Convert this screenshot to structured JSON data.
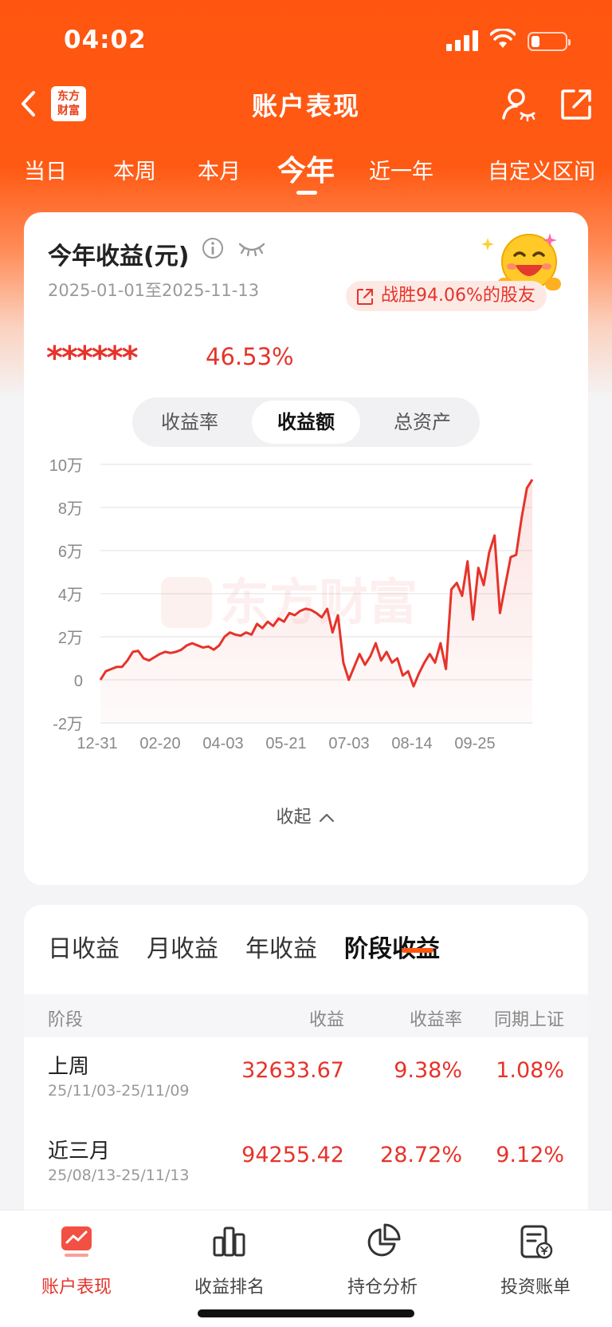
{
  "status_bar": {
    "time": "04:02"
  },
  "nav": {
    "logo_line1": "东方",
    "logo_line2": "财富",
    "title": "账户表现"
  },
  "period_tabs": [
    {
      "label": "当日"
    },
    {
      "label": "本周"
    },
    {
      "label": "本月"
    },
    {
      "label": "今年",
      "active": true
    },
    {
      "label": "近一年"
    },
    {
      "label": "自定义区间"
    }
  ],
  "summary": {
    "title": "今年收益(元)",
    "date_range": "2025-01-01至2025-11-13",
    "beat_text": "战胜94.06%的股友",
    "hidden_amount": "******",
    "return_pct": "46.53%",
    "accent_color": "#e6332a",
    "brand_color": "#ff5510"
  },
  "chart_tabs": [
    {
      "label": "收益率"
    },
    {
      "label": "收益额",
      "active": true
    },
    {
      "label": "总资产"
    }
  ],
  "chart_data": {
    "type": "line",
    "x_ticks": [
      "12-31",
      "02-20",
      "04-03",
      "05-21",
      "07-03",
      "08-14",
      "09-25"
    ],
    "y_ticks": [
      "10万",
      "8万",
      "6万",
      "4万",
      "2万",
      "0",
      "-2万"
    ],
    "ylim": [
      -20000,
      100000
    ],
    "watermark": "东方财富",
    "series": [
      {
        "color": "#e6332a",
        "values": [
          0,
          4000,
          5000,
          6000,
          6000,
          9000,
          13000,
          13500,
          10000,
          9000,
          10500,
          12000,
          13000,
          12500,
          13000,
          14000,
          16000,
          17000,
          16000,
          15000,
          15500,
          14000,
          16000,
          20000,
          22000,
          21000,
          20500,
          22000,
          21000,
          26000,
          24000,
          27000,
          25000,
          28500,
          27000,
          31000,
          30000,
          32000,
          33000,
          32500,
          31000,
          29000,
          33000,
          22000,
          30000,
          8000,
          0,
          6000,
          12000,
          7000,
          11000,
          17000,
          9000,
          13000,
          8000,
          10000,
          2000,
          4000,
          -3000,
          3000,
          8000,
          12000,
          8000,
          17000,
          5000,
          42000,
          45000,
          39000,
          55000,
          28000,
          52000,
          44000,
          59000,
          67000,
          31000,
          44000,
          57000,
          58000,
          75000,
          89000,
          93000
        ]
      }
    ]
  },
  "collapse_label": "收起",
  "returns": {
    "tabs": [
      {
        "label": "日收益"
      },
      {
        "label": "月收益"
      },
      {
        "label": "年收益"
      },
      {
        "label": "阶段收益",
        "active": true
      }
    ],
    "headers": {
      "stage": "阶段",
      "profit": "收益",
      "rate": "收益率",
      "index": "同期上证"
    },
    "rows": [
      {
        "name": "上周",
        "range": "25/11/03-25/11/09",
        "profit": "32633.67",
        "rate": "9.38%",
        "index": "1.08%"
      },
      {
        "name": "近三月",
        "range": "25/08/13-25/11/13",
        "profit": "94255.42",
        "rate": "28.72%",
        "index": "9.12%"
      }
    ]
  },
  "bottom_nav": [
    {
      "label": "账户表现",
      "icon": "trend-icon",
      "active": true
    },
    {
      "label": "收益排名",
      "icon": "bar-chart-icon"
    },
    {
      "label": "持仓分析",
      "icon": "pie-chart-icon"
    },
    {
      "label": "投资账单",
      "icon": "bill-icon"
    }
  ]
}
